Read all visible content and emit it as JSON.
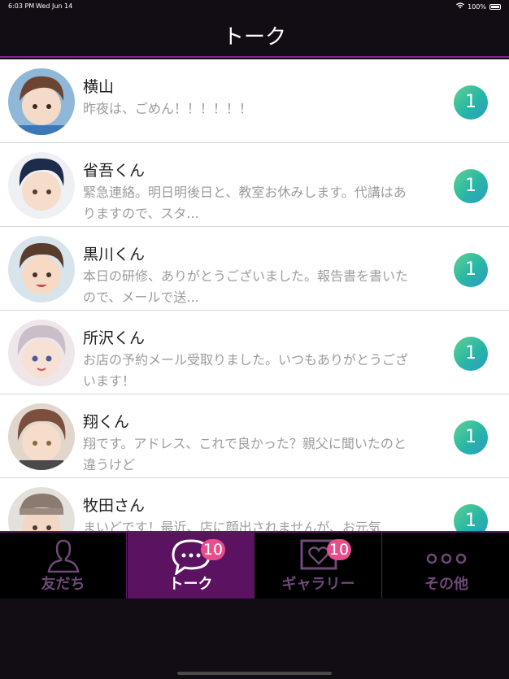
{
  "status": {
    "time": "6:03 PM",
    "date": "Wed Jun 14",
    "wifi": "wifi-icon",
    "battery": "100%"
  },
  "header": {
    "title": "トーク"
  },
  "chats": [
    {
      "name": "横山",
      "message": "昨夜は、ごめん！！！！！！",
      "unread": "1"
    },
    {
      "name": "省吾くん",
      "message": "緊急連絡。明日明後日と、教室お休みします。代講はありますので、スタ...",
      "unread": "1"
    },
    {
      "name": "黒川くん",
      "message": "本日の研修、ありがとうございました。報告書を書いたので、メールで送...",
      "unread": "1"
    },
    {
      "name": "所沢くん",
      "message": "お店の予約メール受取りました。いつもありがとうございます！",
      "unread": "1"
    },
    {
      "name": "翔くん",
      "message": "翔です。アドレス、これで良かった？親父に聞いたのと違うけど",
      "unread": "1"
    },
    {
      "name": "牧田さん",
      "message": "まいどです！最近、店に顔出されませんが、お元気",
      "unread": "1"
    }
  ],
  "tabs": [
    {
      "label": "友だち",
      "icon": "person-icon"
    },
    {
      "label": "トーク",
      "icon": "chat-bubble-icon",
      "count": "10"
    },
    {
      "label": "ギャラリー",
      "icon": "gallery-heart-icon",
      "count": "10"
    },
    {
      "label": "その他",
      "icon": "more-dots-icon"
    }
  ],
  "colors": {
    "accent": "#5b1361",
    "badge": "#27b6a6",
    "tab_count": "#e84e8c"
  }
}
